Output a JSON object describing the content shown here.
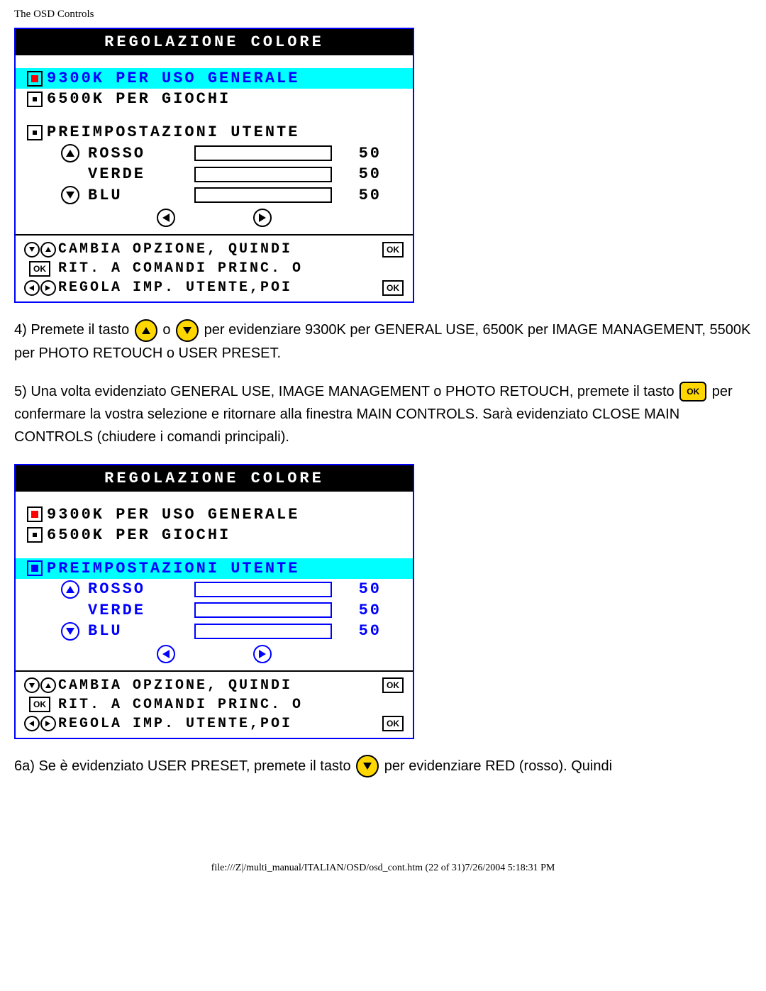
{
  "header": "The OSD Controls",
  "osd_title": "REGOLAZIONE COLORE",
  "options": {
    "opt1": "9300K PER USO GENERALE",
    "opt2": "6500K PER GIOCHI",
    "preset": "PREIMPOSTAZIONI UTENTE"
  },
  "rgb": {
    "red_label": "ROSSO",
    "green_label": "VERDE",
    "blue_label": "BLU",
    "red_val": "50",
    "green_val": "50",
    "blue_val": "50"
  },
  "hints": {
    "h1": "CAMBIA OPZIONE, QUINDI",
    "h2": "RIT. A COMANDI PRINC. O",
    "h3": "REGOLA IMP. UTENTE,POI"
  },
  "ok_label": "OK",
  "para4_a": "4) Premete il tasto ",
  "para4_b": " o ",
  "para4_c": " per evidenziare 9300K per GENERAL USE, 6500K per IMAGE MANAGEMENT, 5500K per PHOTO RETOUCH o USER PRESET.",
  "para5_a": "5) Una volta evidenziato GENERAL USE, IMAGE MANAGEMENT o PHOTO RETOUCH, premete il tasto ",
  "para5_b": " per confermare la vostra selezione e ritornare alla finestra MAIN CONTROLS. Sarà evidenziato CLOSE MAIN CONTROLS (chiudere i comandi principali).",
  "para6_a": "6a) Se è evidenziato USER PRESET, premete il tasto ",
  "para6_b": " per evidenziare RED (rosso). Quindi",
  "footer_path": "file:///Z|/multi_manual/ITALIAN/OSD/osd_cont.htm (22 of 31)7/26/2004 5:18:31 PM"
}
